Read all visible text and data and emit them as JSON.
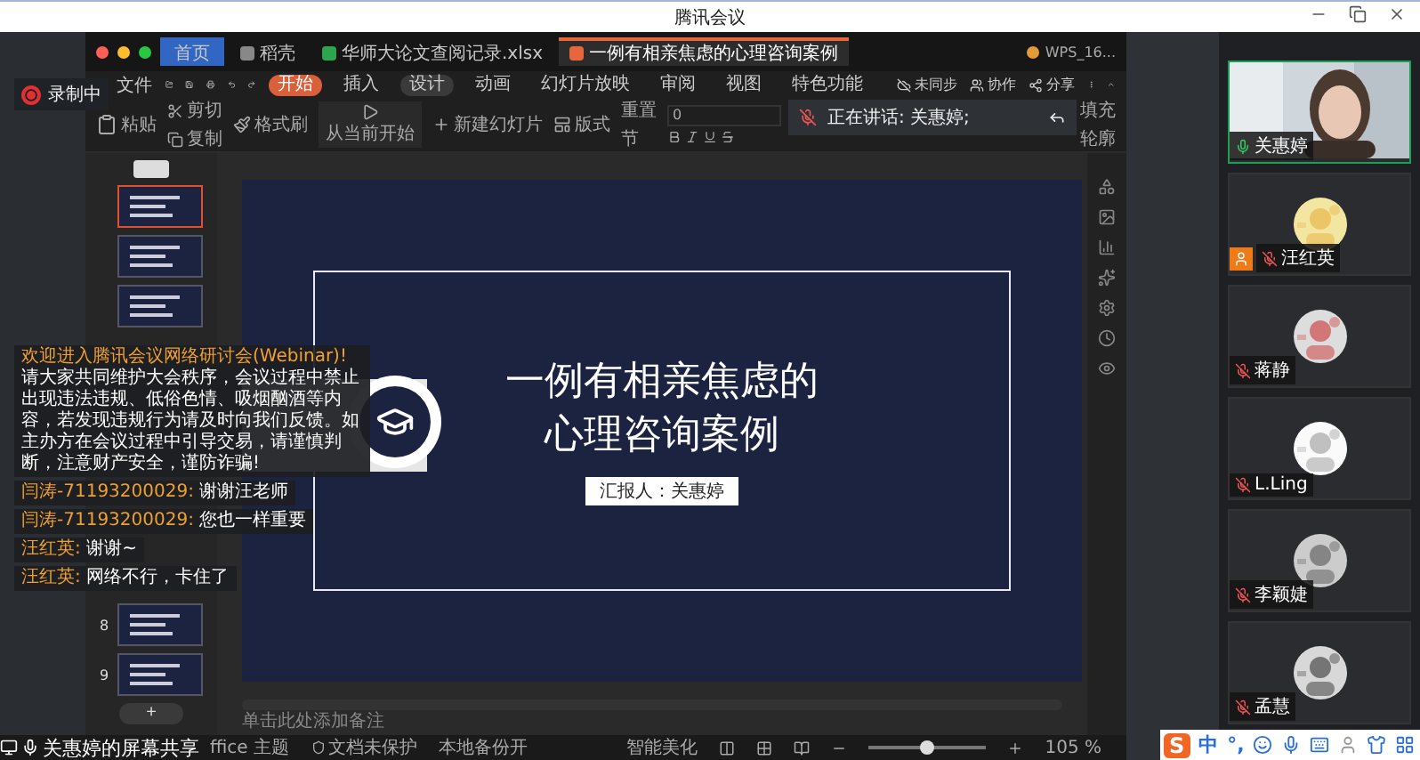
{
  "window": {
    "title": "腾讯会议"
  },
  "recording": {
    "label": "录制中"
  },
  "wps": {
    "tabs": [
      {
        "label": "首页",
        "kind": "home",
        "selected": false
      },
      {
        "label": "稻壳",
        "kind": "docer",
        "selected": false
      },
      {
        "label": "华师大论文查阅记录.xlsx",
        "kind": "sheet",
        "selected": false
      },
      {
        "label": "一例有相亲焦虑的心理咨询案例",
        "kind": "slides",
        "selected": true
      }
    ],
    "account": "WPS_16...",
    "menu_file": "文件",
    "menu": [
      {
        "label": "开始",
        "selected": true,
        "hovered": false
      },
      {
        "label": "插入",
        "selected": false,
        "hovered": false
      },
      {
        "label": "设计",
        "selected": false,
        "hovered": true
      },
      {
        "label": "动画",
        "selected": false,
        "hovered": false
      },
      {
        "label": "幻灯片放映",
        "selected": false,
        "hovered": false
      },
      {
        "label": "审阅",
        "selected": false,
        "hovered": false
      },
      {
        "label": "视图",
        "selected": false,
        "hovered": false
      },
      {
        "label": "特色功能",
        "selected": false,
        "hovered": false
      }
    ],
    "menu_actions": [
      {
        "kind": "sync",
        "label": "未同步"
      },
      {
        "kind": "collab",
        "label": "协作"
      },
      {
        "kind": "share",
        "label": "分享"
      }
    ],
    "ribbon": {
      "paste": "粘贴",
      "cut": "剪切",
      "copy": "复制",
      "format_painter": "格式刷",
      "play": "从当前开始",
      "new_slide": "新建幻灯片",
      "layout": "版式",
      "reset": "重置",
      "section": "节",
      "font_size": "0",
      "fill": "填充",
      "outline": "轮廓"
    },
    "thumbnails": [
      {
        "selected": true
      },
      {
        "selected": false
      },
      {
        "selected": false
      },
      {
        "number": "8",
        "selected": false
      },
      {
        "number": "9",
        "selected": false
      }
    ],
    "add_slide": "+",
    "slide": {
      "title_lines": [
        "一例有相亲焦虑的",
        "心理咨询案例"
      ],
      "presenter": "汇报人：关惠婷"
    },
    "notes_placeholder": "单击此处添加备注",
    "status": {
      "theme": "ffice 主题",
      "protection": "文档未保护",
      "backup": "本地备份开",
      "beautify": "智能美化",
      "zoom": {
        "level": 0.5
      },
      "zoom_reading": "105 %"
    }
  },
  "speaking": {
    "label": "正在讲话: 关惠婷;"
  },
  "chat": [
    {
      "kind": "notice",
      "title": "欢迎进入腾讯会议网络研讨会(Webinar)!",
      "text": "请大家共同维护大会秩序，会议过程中禁止出现违法违规、低俗色情、吸烟酗酒等内容，若发现违规行为请及时向我们反馈。如主办方在会议过程中引导交易，请谨慎判断，注意财产安全，谨防诈骗!"
    },
    {
      "kind": "message",
      "sender": "闫涛-71193200029:",
      "text": "谢谢汪老师"
    },
    {
      "kind": "message",
      "sender": "闫涛-71193200029:",
      "text": "您也一样重要"
    },
    {
      "kind": "message",
      "sender": "汪红英:",
      "text": "谢谢~"
    },
    {
      "kind": "message",
      "sender": "汪红英:",
      "text": "网络不行，卡住了"
    }
  ],
  "screen_share": {
    "label": "关惠婷的屏幕共享"
  },
  "participants": [
    {
      "name": "关惠婷",
      "kind": "video",
      "muted": false,
      "host": false,
      "speaking": true
    },
    {
      "name": "汪红英",
      "kind": "avatar",
      "muted": true,
      "host": true,
      "speaking": false
    },
    {
      "name": "蒋静",
      "kind": "avatar",
      "muted": true,
      "host": false,
      "speaking": false
    },
    {
      "name": "L.Ling",
      "kind": "avatar",
      "muted": true,
      "host": false,
      "speaking": false
    },
    {
      "name": "李颖婕",
      "kind": "avatar",
      "muted": true,
      "host": false,
      "speaking": false
    },
    {
      "name": "孟慧",
      "kind": "avatar",
      "muted": true,
      "host": false,
      "speaking": false
    }
  ],
  "ime": {
    "logo": "S",
    "mode": "中",
    "punctuation": "°,"
  }
}
